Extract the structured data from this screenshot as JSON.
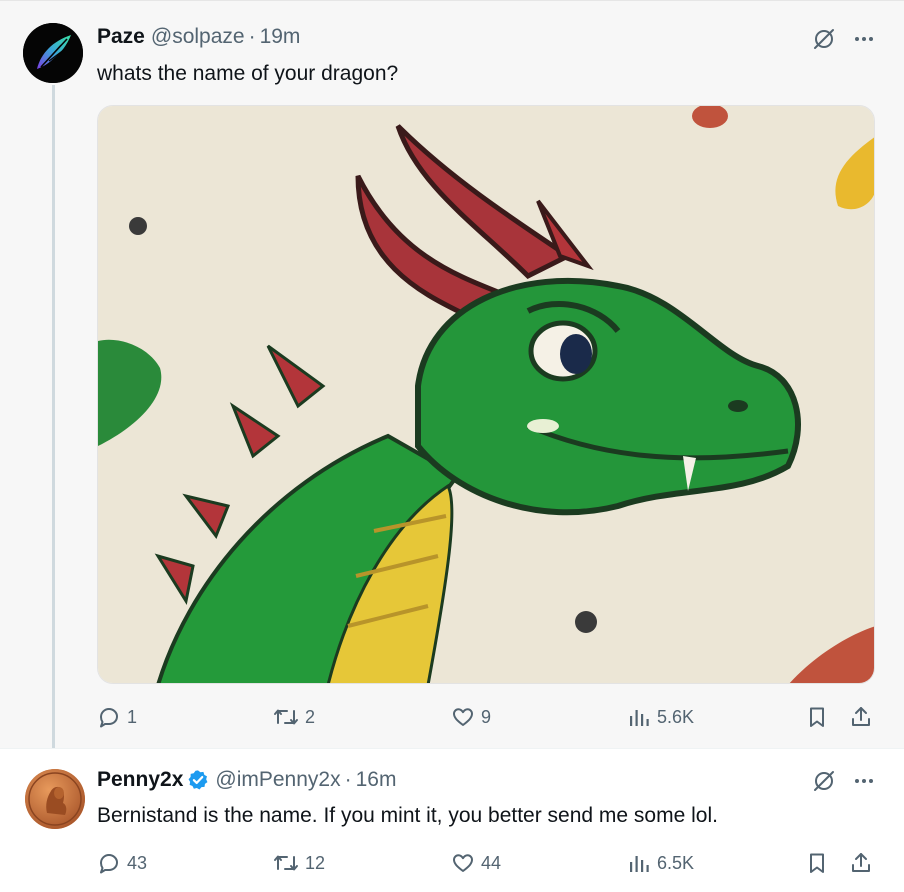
{
  "tweets": [
    {
      "author_name": "Paze",
      "handle": "@solpaze",
      "separator": "·",
      "time": "19m",
      "text": "whats the name of your dragon?",
      "stats": {
        "replies": "1",
        "retweets": "2",
        "likes": "9",
        "views": "5.6K"
      },
      "has_media": true,
      "verified": false
    },
    {
      "author_name": "Penny2x",
      "handle": "@imPenny2x",
      "separator": "·",
      "time": "16m",
      "text": "Bernistand is the name. If you mint it, you better send me some lol.",
      "stats": {
        "replies": "43",
        "retweets": "12",
        "likes": "44",
        "views": "6.5K"
      },
      "has_media": false,
      "verified": true
    }
  ],
  "colors": {
    "secondary_text": "#536471",
    "primary_text": "#0f1419",
    "verified_blue": "#1d9bf0",
    "thread_line": "#cfd9de"
  },
  "icons": [
    "grok-icon",
    "more-icon",
    "reply-icon",
    "retweet-icon",
    "like-icon",
    "views-icon",
    "bookmark-icon",
    "share-icon",
    "verified-badge-icon"
  ]
}
